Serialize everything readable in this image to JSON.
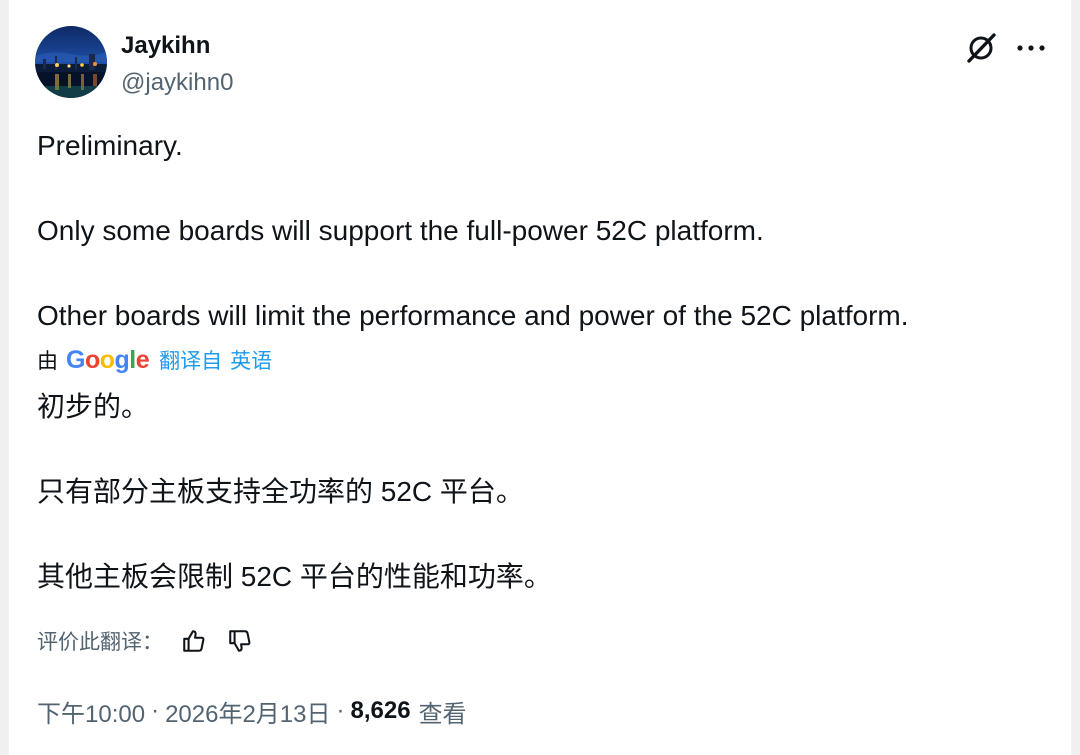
{
  "author": {
    "name": "Jaykihn",
    "handle": "@jaykihn0"
  },
  "tweet": {
    "paragraphs": [
      "Preliminary.",
      "Only some boards will support the full-power 52C platform.",
      "Other boards will limit the performance and power of the 52C platform."
    ]
  },
  "translation": {
    "by_label": "由",
    "provider": "Google",
    "provider_letters": [
      "G",
      "o",
      "o",
      "g",
      "l",
      "e"
    ],
    "provider_colors": [
      "#4285F4",
      "#EA4335",
      "#FBBC05",
      "#4285F4",
      "#34A853",
      "#EA4335"
    ],
    "translated_from": "翻译自",
    "source_language": "英语",
    "paragraphs": [
      "初步的。",
      "只有部分主板支持全功率的 52C 平台。",
      "其他主板会限制 52C 平台的性能和功率。"
    ],
    "rate_label": "评价此翻译："
  },
  "meta": {
    "time": "下午10:00",
    "separator": "·",
    "date": "2026年2月13日",
    "views_count": "8,626",
    "views_label": "查看"
  },
  "icons": {
    "grok": "grok-icon",
    "more": "more-icon",
    "thumbs_up": "thumbs-up-icon",
    "thumbs_down": "thumbs-down-icon"
  },
  "colors": {
    "text_primary": "#0f1419",
    "text_secondary": "#536471",
    "link": "#1d9bf0"
  }
}
